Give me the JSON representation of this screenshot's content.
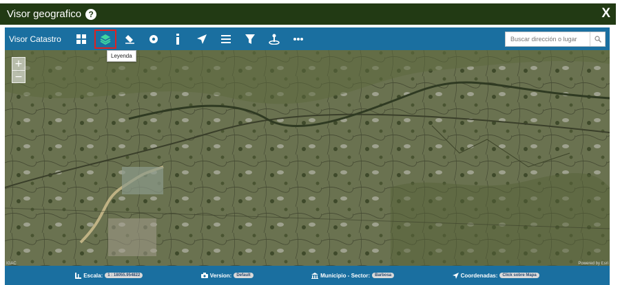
{
  "window": {
    "title": "Visor geografico",
    "help_glyph": "?",
    "close_glyph": "X"
  },
  "toolbar": {
    "title": "Visor Catastro",
    "tools": [
      {
        "name": "grid-icon",
        "label": "Cuadricula"
      },
      {
        "name": "layers-icon",
        "label": "Leyenda",
        "active": true
      },
      {
        "name": "eraser-icon",
        "label": "Borrar"
      },
      {
        "name": "target-icon",
        "label": "Ubicar"
      },
      {
        "name": "info-icon",
        "label": "Informacion"
      },
      {
        "name": "navigate-icon",
        "label": "Navegar"
      },
      {
        "name": "list-icon",
        "label": "Lista"
      },
      {
        "name": "filter-icon",
        "label": "Filtro"
      },
      {
        "name": "pin-icon",
        "label": "Ubicacion"
      },
      {
        "name": "more-icon",
        "label": "Mas"
      }
    ],
    "tooltip": "Leyenda",
    "search_placeholder": "Buscar dirección o lugar"
  },
  "map": {
    "zoom_in": "+",
    "zoom_out": "−",
    "attribution_left": "IGAC",
    "attribution_right": "Powered by Esri"
  },
  "status": {
    "scale_label": "Escala:",
    "scale_value": "1 : 18055.954822",
    "version_label": "Version:",
    "version_value": "Default",
    "municipio_label": "Municipio - Sector:",
    "municipio_value": "Barbosa",
    "coords_label": "Coordenadas:",
    "coords_value": "Click sobre Mapa"
  },
  "colors": {
    "titlebar": "#223a14",
    "toolbar": "#1a6fa0",
    "active_tool_outline": "#e02020",
    "active_tool_icon": "#3fd6a0"
  }
}
